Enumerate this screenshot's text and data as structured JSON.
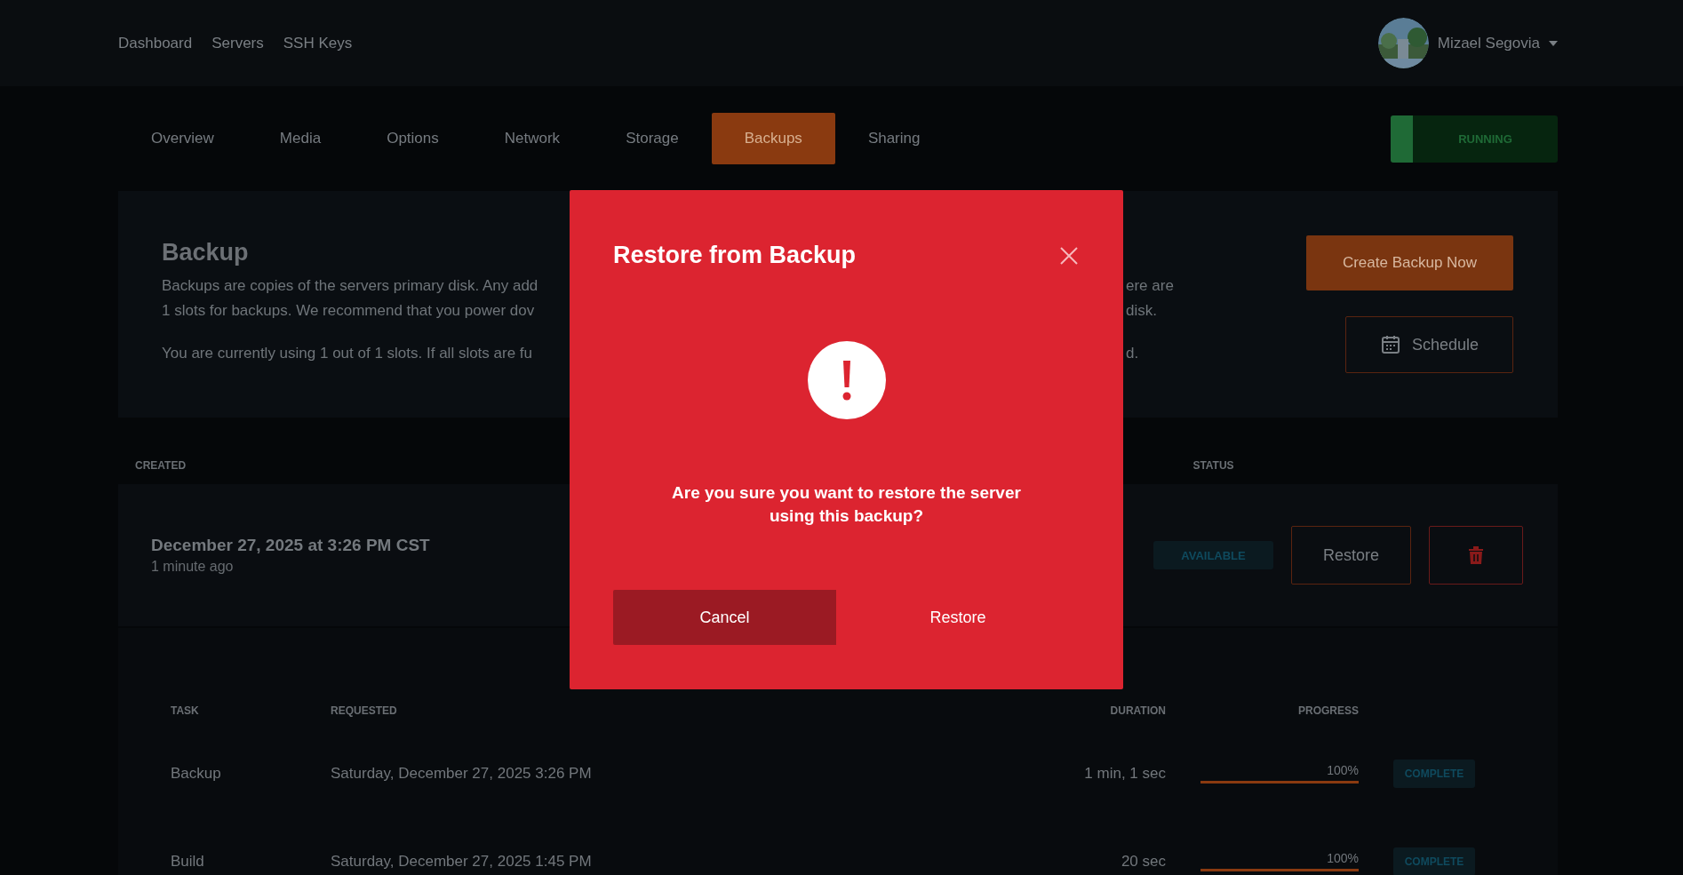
{
  "nav": {
    "links": [
      {
        "label": "Dashboard"
      },
      {
        "label": "Servers"
      },
      {
        "label": "SSH Keys"
      }
    ],
    "user": {
      "name": "Mizael Segovia"
    }
  },
  "tabs": [
    {
      "label": "Overview",
      "selected": false
    },
    {
      "label": "Media",
      "selected": false
    },
    {
      "label": "Options",
      "selected": false
    },
    {
      "label": "Network",
      "selected": false
    },
    {
      "label": "Storage",
      "selected": false
    },
    {
      "label": "Backups",
      "selected": true
    },
    {
      "label": "Sharing",
      "selected": false
    }
  ],
  "server_status": {
    "label": "RUNNING"
  },
  "backup": {
    "title": "Backup",
    "description_lines": [
      {
        "left": "Backups are copies of the servers primary disk. Any add",
        "right": "ere are"
      },
      {
        "left": "1 slots for backups. We recommend that you power dov",
        "right": "disk."
      }
    ],
    "usage": {
      "left": "You are currently using 1 out of 1 slots. If all slots are fu",
      "right": "d."
    },
    "actions": [
      {
        "label": "Create Backup Now",
        "kind": "primary"
      },
      {
        "label": "Schedule",
        "kind": "schedule"
      }
    ]
  },
  "backups_table": {
    "columns": [
      "CREATED",
      "STATUS"
    ],
    "rows": [
      {
        "created": "December 27, 2025 at 3:26 PM CST",
        "age": "1 minute ago",
        "status": "AVAILABLE",
        "actions": [
          {
            "kind": "restore",
            "label": "Restore"
          },
          {
            "kind": "delete"
          }
        ]
      }
    ]
  },
  "tasks_table": {
    "columns": [
      "TASK",
      "REQUESTED",
      "DURATION",
      "PROGRESS"
    ],
    "rows": [
      {
        "task": "Backup",
        "requested": "Saturday, December 27, 2025 3:26 PM",
        "duration": "1 min, 1 sec",
        "progress": "100%",
        "level": 1,
        "status": "COMPLETE"
      },
      {
        "task": "Build",
        "requested": "Saturday, December 27, 2025 1:45 PM",
        "duration": "20 sec",
        "progress": "100%",
        "level": 1,
        "status": "COMPLETE"
      }
    ]
  },
  "dialog": {
    "title": "Restore from Backup",
    "message": "Are you sure you want to restore the server using this backup?",
    "buttons": [
      {
        "label": "Cancel",
        "kind": "secondary"
      },
      {
        "label": "Restore",
        "kind": "confirm"
      }
    ]
  }
}
